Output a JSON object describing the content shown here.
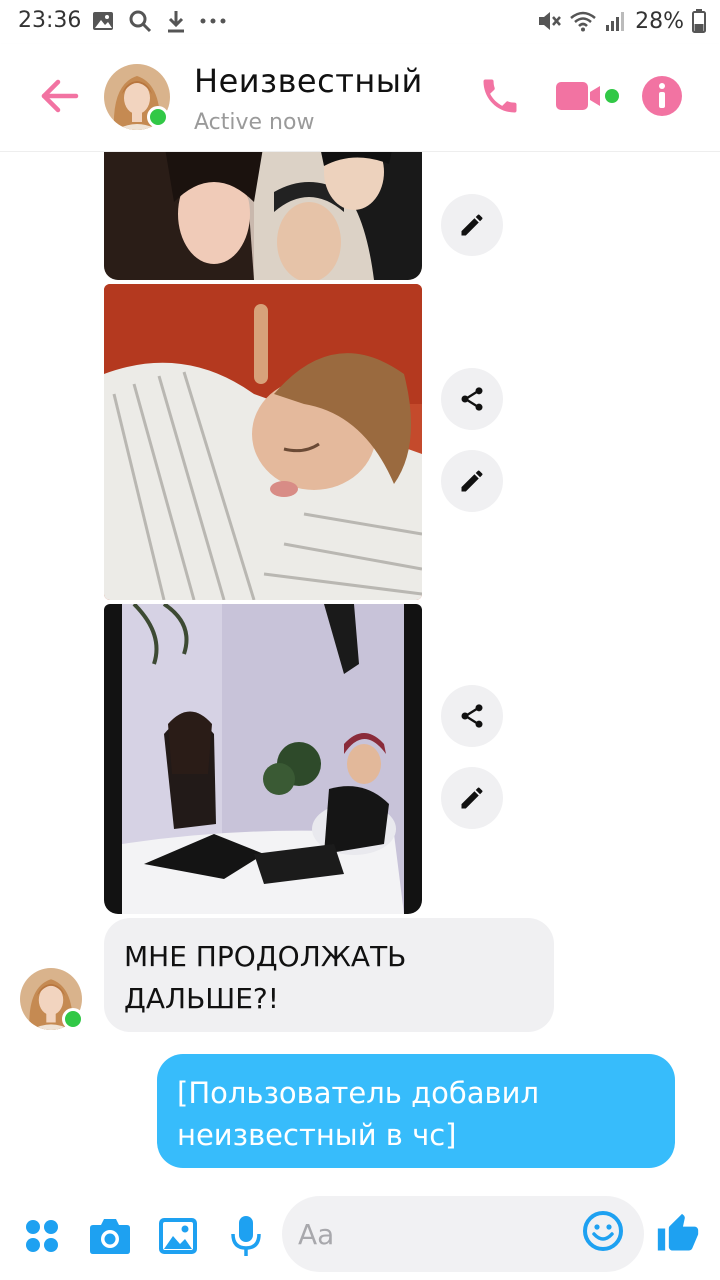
{
  "status_bar": {
    "time": "23:36",
    "battery": "28%"
  },
  "header": {
    "contact_name": "Неизвестный",
    "presence": "Active now",
    "online": true,
    "accent_color": "#f273a2",
    "icons": [
      "back-arrow-icon",
      "phone-icon",
      "video-camera-icon",
      "info-icon"
    ]
  },
  "messages": [
    {
      "type": "image",
      "from": "contact",
      "icons": [
        "pencil-icon"
      ]
    },
    {
      "type": "image",
      "from": "contact",
      "icons": [
        "share-icon",
        "pencil-icon"
      ]
    },
    {
      "type": "image",
      "from": "contact",
      "icons": [
        "share-icon",
        "pencil-icon"
      ]
    },
    {
      "type": "text",
      "from": "contact",
      "text": " МНЕ ПРОДОЛЖАТЬ\nДАЛЬШЕ?!"
    },
    {
      "type": "text",
      "from": "me",
      "text": "[Пользователь добавил\nнеизвестный в чс]",
      "color": "#37bcfb"
    }
  ],
  "composer": {
    "placeholder": "Aa",
    "icon_color": "#1ea1f1",
    "icons": [
      "apps-icon",
      "camera-icon",
      "gallery-icon",
      "microphone-icon",
      "emoji-icon",
      "thumbs-up-icon"
    ]
  }
}
